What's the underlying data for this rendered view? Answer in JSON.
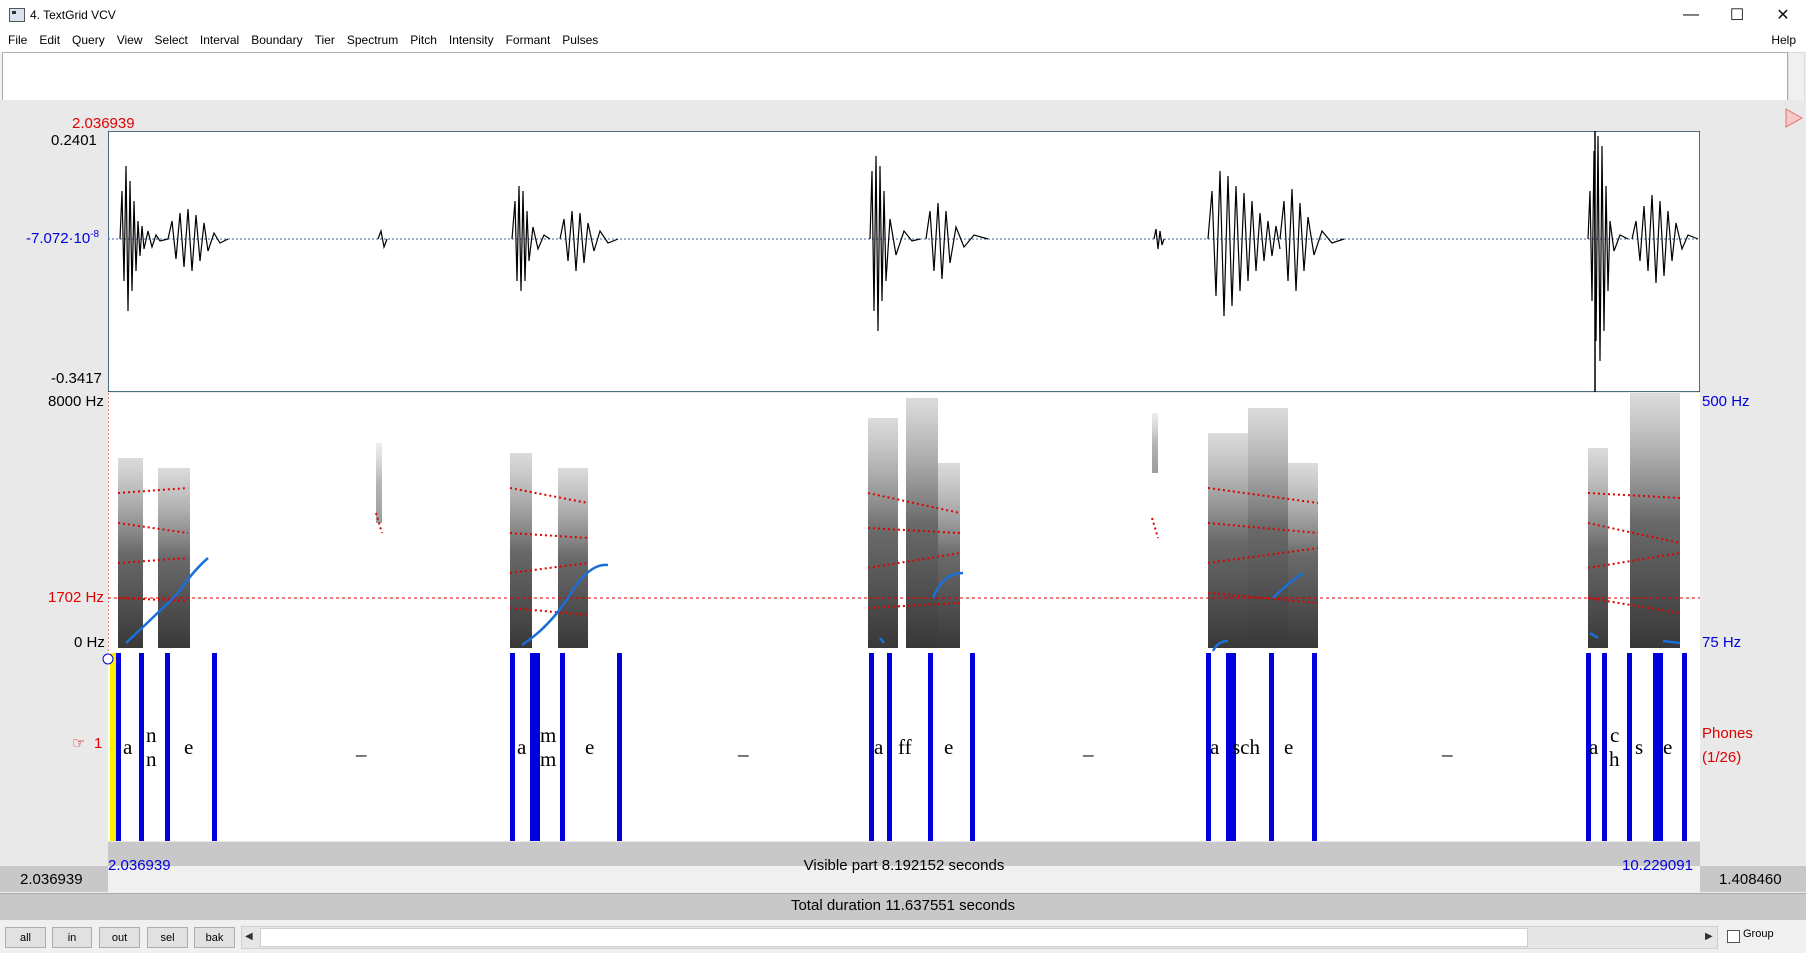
{
  "window": {
    "title": "4. TextGrid VCV",
    "minimize": "—",
    "maximize": "☐",
    "close": "✕"
  },
  "menu": [
    "File",
    "Edit",
    "Query",
    "View",
    "Select",
    "Interval",
    "Boundary",
    "Tier",
    "Spectrum",
    "Pitch",
    "Intensity",
    "Formant",
    "Pulses"
  ],
  "help": "Help",
  "cursor_time": "2.036939",
  "waveform": {
    "max": "0.2401",
    "mid": "-7.072·10",
    "mid_exp": "-8",
    "min": "-0.3417"
  },
  "spectrogram": {
    "top_left": "8000 Hz",
    "cursor_freq": "1702 Hz",
    "bottom_left": "0 Hz",
    "top_right": "500 Hz",
    "bottom_right": "75 Hz"
  },
  "tier": {
    "number": "1",
    "name": "Phones",
    "count": "(1/26)",
    "labels": [
      "a",
      "n",
      "n",
      "e",
      "_",
      "a",
      "m",
      "m",
      "e",
      "_",
      "a",
      "ff",
      "e",
      "_",
      "a",
      "sch",
      "e",
      "_",
      "a",
      "c",
      "h",
      "s",
      "e"
    ]
  },
  "time_axis": {
    "visible_start": "2.036939",
    "visible_end": "10.229091",
    "visible_part": "Visible part 8.192152 seconds",
    "left_total": "2.036939",
    "right_total": "1.408460",
    "total_duration": "Total duration 11.637551 seconds"
  },
  "buttons": {
    "all": "all",
    "in": "in",
    "out": "out",
    "sel": "sel",
    "bak": "bak"
  },
  "group_label": "Group",
  "colors": {
    "pitch": "#1a6fd8",
    "formant": "#e00000",
    "boundary": "#0000dd",
    "selection": "#ffee00"
  }
}
